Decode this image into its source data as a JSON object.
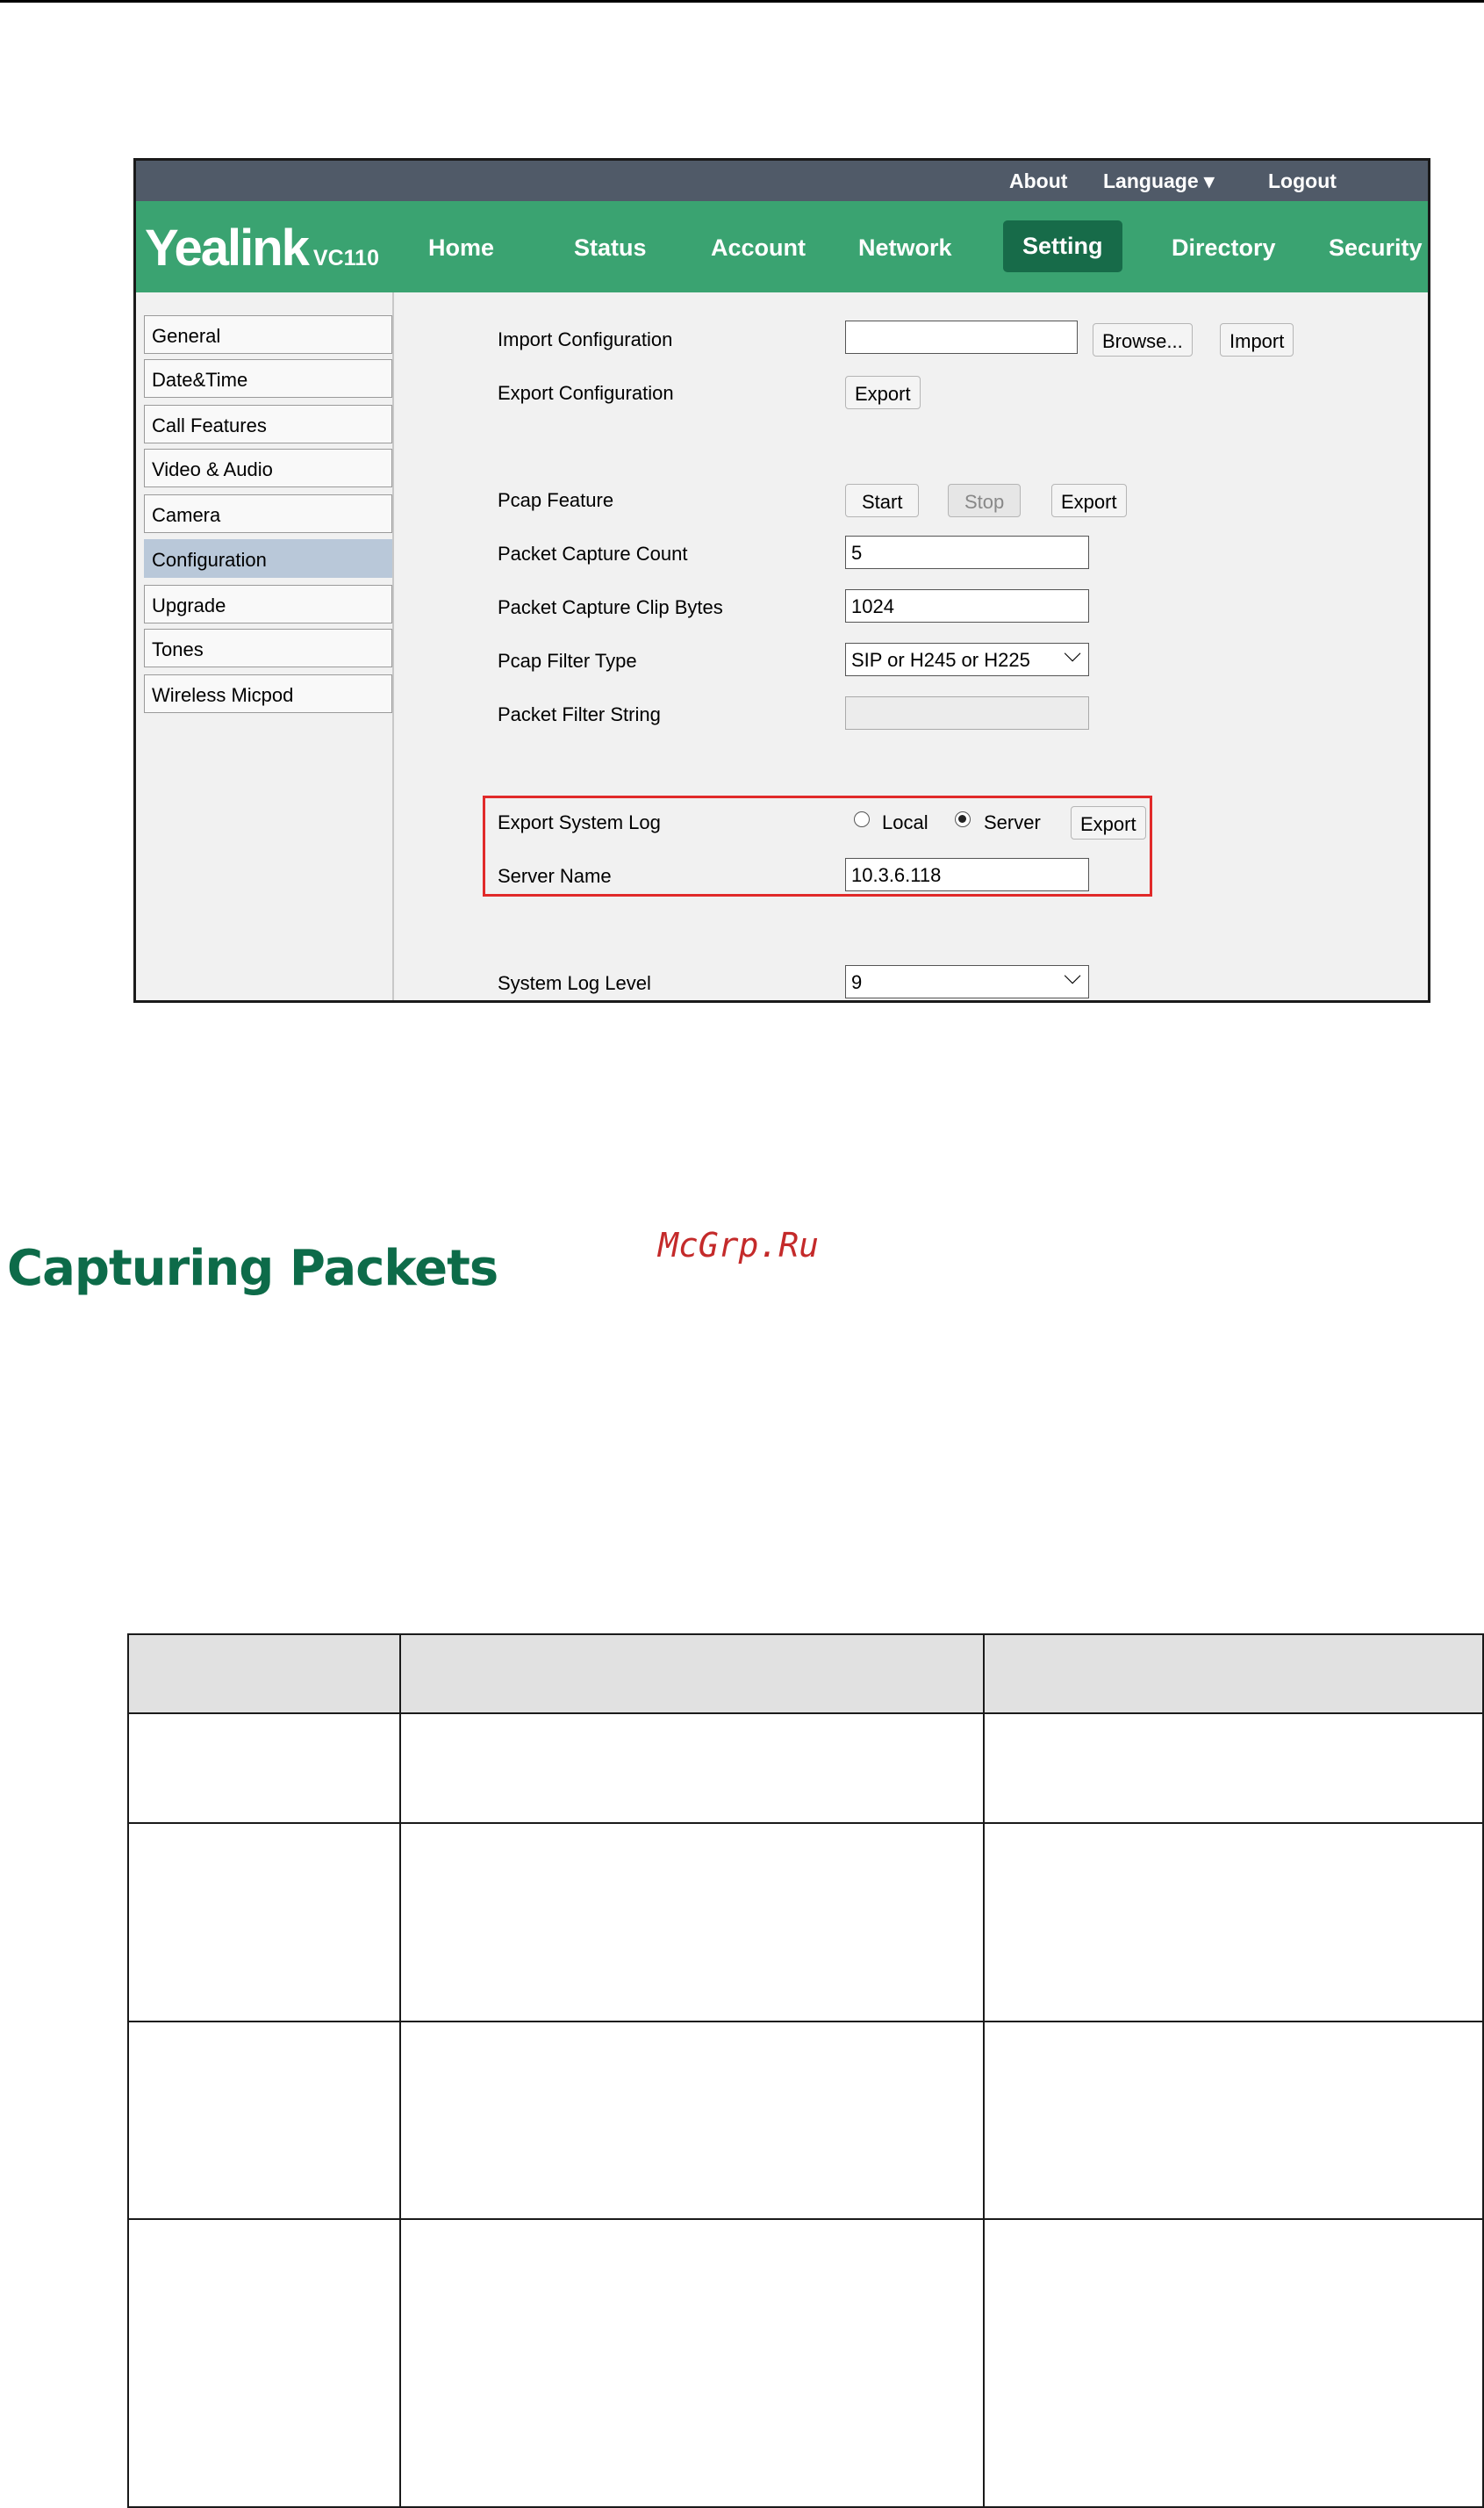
{
  "topbar": {
    "about": "About",
    "language": "Language ▾",
    "logout": "Logout"
  },
  "logo": {
    "brand": "Yealink",
    "model": "VC110"
  },
  "nav": [
    "Home",
    "Status",
    "Account",
    "Network",
    "Setting",
    "Directory",
    "Security"
  ],
  "sidebar": [
    "General",
    "Date&Time",
    "Call Features",
    "Video & Audio",
    "Camera",
    "Configuration",
    "Upgrade",
    "Tones",
    "Wireless Micpod"
  ],
  "form": {
    "import_label": "Import Configuration",
    "browse": "Browse...",
    "import_btn": "Import",
    "export_cfg_label": "Export Configuration",
    "export": "Export",
    "pcap_label": "Pcap Feature",
    "start": "Start",
    "stop": "Stop",
    "count_label": "Packet Capture Count",
    "count_value": "5",
    "clip_label": "Packet Capture Clip Bytes",
    "clip_value": "1024",
    "filter_type_label": "Pcap Filter Type",
    "filter_type_value": "SIP or H245 or H225",
    "filter_string_label": "Packet Filter String",
    "syslog_label": "Export System Log",
    "local": "Local",
    "server": "Server",
    "server_name_label": "Server Name",
    "server_name_value": "10.3.6.118",
    "log_level_label": "System Log Level",
    "log_level_value": "9"
  },
  "heading": "Capturing Packets",
  "watermark": "McGrp.Ru"
}
